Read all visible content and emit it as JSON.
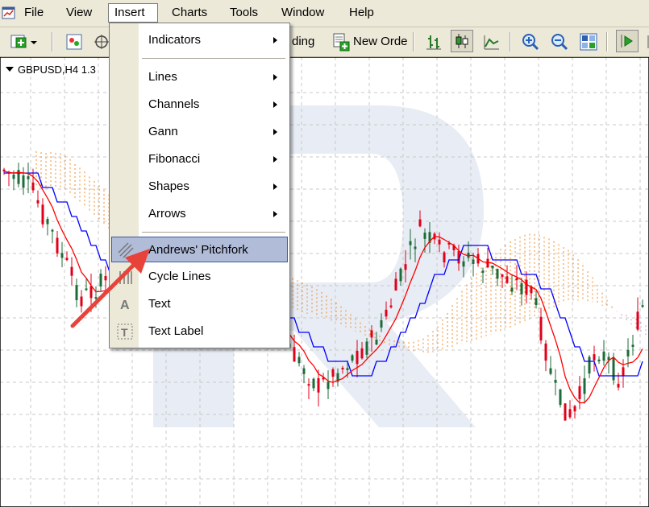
{
  "menubar": {
    "items": [
      "File",
      "View",
      "Insert",
      "Charts",
      "Tools",
      "Window",
      "Help"
    ]
  },
  "toolbar": {
    "partial_trading_label": "ding",
    "new_order_label": "New Orde"
  },
  "chart": {
    "symbol_label": "GBPUSD,H4  1.3",
    "colors": {
      "bull": "#1e6b3a",
      "bear": "#e0001a",
      "tenkan": "#ff0000",
      "kijun": "#0000ff",
      "cloud_a": "#f28c28",
      "cloud_b": "#c8a0c8",
      "grid": "#c9c9c9"
    }
  },
  "insert_menu": {
    "items": [
      {
        "label": "Indicators",
        "submenu": true
      },
      {
        "label": "Lines",
        "submenu": true
      },
      {
        "label": "Channels",
        "submenu": true
      },
      {
        "label": "Gann",
        "submenu": true
      },
      {
        "label": "Fibonacci",
        "submenu": true
      },
      {
        "label": "Shapes",
        "submenu": true
      },
      {
        "label": "Arrows",
        "submenu": true
      },
      {
        "label": "Andrews' Pitchfork",
        "icon": "pitchfork-icon",
        "highlighted": true
      },
      {
        "label": "Cycle Lines",
        "icon": "cycle-lines-icon"
      },
      {
        "label": "Text",
        "icon": "text-icon"
      },
      {
        "label": "Text Label",
        "icon": "text-label-icon"
      }
    ]
  }
}
